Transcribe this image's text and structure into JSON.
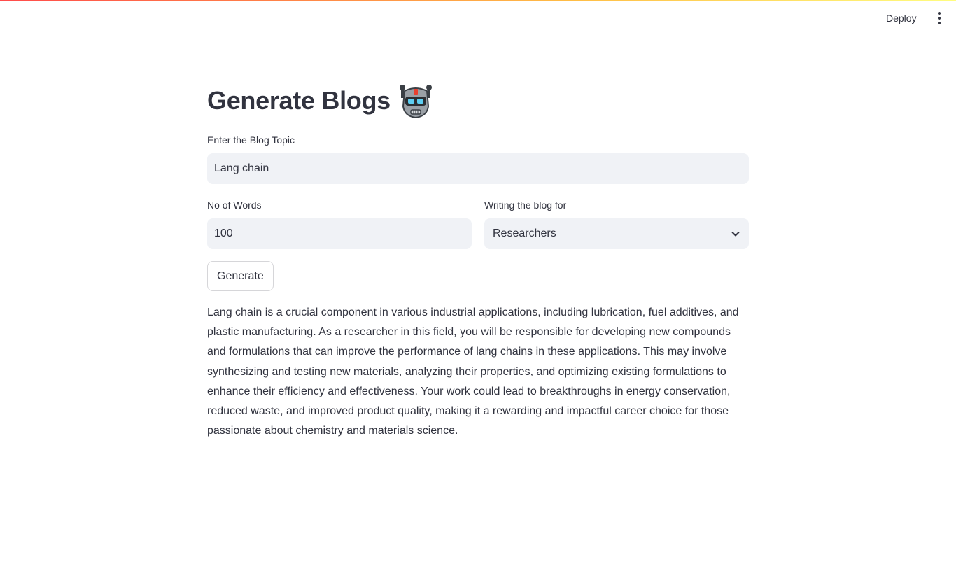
{
  "header": {
    "deploy_label": "Deploy",
    "menu_icon": "kebab-menu-icon"
  },
  "page": {
    "title": "Generate Blogs",
    "title_emoji_icon": "robot-icon"
  },
  "form": {
    "topic": {
      "label": "Enter the Blog Topic",
      "value": "Lang chain"
    },
    "words": {
      "label": "No of Words",
      "value": "100"
    },
    "audience": {
      "label": "Writing the blog for",
      "selected": "Researchers"
    },
    "generate_label": "Generate"
  },
  "output": {
    "text": "Lang chain is a crucial component in various industrial applications, including lubrication, fuel additives, and plastic manufacturing. As a researcher in this field, you will be responsible for developing new compounds and formulations that can improve the performance of lang chains in these applications. This may involve synthesizing and testing new materials, analyzing their properties, and optimizing existing formulations to enhance their efficiency and effectiveness. Your work could lead to breakthroughs in energy conservation, reduced waste, and improved product quality, making it a rewarding and impactful career choice for those passionate about chemistry and materials science."
  },
  "colors": {
    "accent_gradient_start": "#ff4b4b",
    "accent_gradient_end": "#fffd80",
    "input_background": "#f0f2f6",
    "text": "#31333f"
  }
}
